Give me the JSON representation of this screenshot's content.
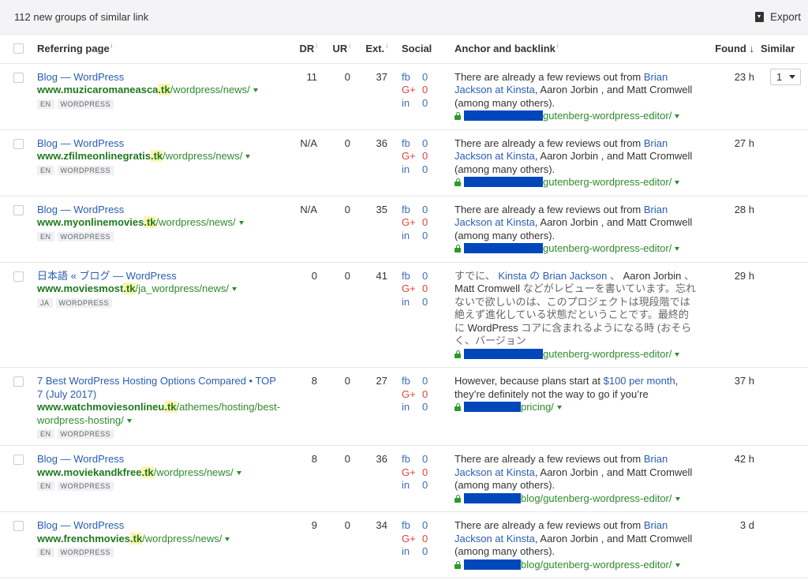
{
  "topbar": {
    "summary": "112 new groups of similar link",
    "export_label": "Export"
  },
  "columns": {
    "referring": "Referring page",
    "dr": "DR",
    "ur": "UR",
    "ext": "Ext.",
    "social": "Social",
    "anchor": "Anchor and backlink",
    "found": "Found",
    "similar": "Similar",
    "info": "i",
    "sort": "↓"
  },
  "social_labels": {
    "fb": "fb",
    "gp": "G+",
    "in": "in"
  },
  "rows": [
    {
      "title": "Blog — WordPress",
      "domain_pre": "www.muzicaromaneasca",
      "tld": ".tk",
      "path": "/wordpress/news/",
      "tags": [
        "EN",
        "WORDPRESS"
      ],
      "dr": "11",
      "ur": "0",
      "ext": "37",
      "fb": "0",
      "gp": "0",
      "in": "0",
      "anchor": [
        {
          "t": "There are already a few reviews out from "
        },
        {
          "t": "Brian Jackson at Kinsta",
          "l": 1
        },
        {
          "t": ", Aaron Jorbin , and Matt Cromwell (among many others)."
        }
      ],
      "redact": 100,
      "backlink": "gutenberg-wordpress-editor/",
      "found": "23 h",
      "similar": "1"
    },
    {
      "title": "Blog — WordPress",
      "domain_pre": "www.zfilmeonlinegratis",
      "tld": ".tk",
      "path": "/wordpress/news/",
      "tags": [
        "EN",
        "WORDPRESS"
      ],
      "dr": "N/A",
      "ur": "0",
      "ext": "36",
      "fb": "0",
      "gp": "0",
      "in": "0",
      "anchor": [
        {
          "t": "There are already a few reviews out from "
        },
        {
          "t": "Brian Jackson at Kinsta",
          "l": 1
        },
        {
          "t": ", Aaron Jorbin , and Matt Cromwell (among many others)."
        }
      ],
      "redact": 100,
      "backlink": "gutenberg-wordpress-editor/",
      "found": "27 h"
    },
    {
      "title": "Blog — WordPress",
      "domain_pre": "www.myonlinemovies",
      "tld": ".tk",
      "path": "/wordpress/news/",
      "tags": [
        "EN",
        "WORDPRESS"
      ],
      "dr": "N/A",
      "ur": "0",
      "ext": "35",
      "fb": "0",
      "gp": "0",
      "in": "0",
      "anchor": [
        {
          "t": "There are already a few reviews out from "
        },
        {
          "t": "Brian Jackson at Kinsta",
          "l": 1
        },
        {
          "t": ", Aaron Jorbin , and Matt Cromwell (among many others)."
        }
      ],
      "redact": 100,
      "backlink": "gutenberg-wordpress-editor/",
      "found": "28 h"
    },
    {
      "title": "日本語 « ブログ — WordPress",
      "domain_pre": "www.moviesmost",
      "tld": ".tk",
      "path": "/ja_wordpress/news/",
      "tags": [
        "JA",
        "WORDPRESS"
      ],
      "dr": "0",
      "ur": "0",
      "ext": "41",
      "fb": "0",
      "gp": "0",
      "in": "0",
      "ja": true,
      "anchor": [
        {
          "t": "すでに、 "
        },
        {
          "t": "Kinsta の Brian Jackson",
          "l": 1
        },
        {
          "t": " 、 "
        },
        {
          "t": "Aaron Jorbin",
          "e": 1
        },
        {
          "t": " 、 "
        },
        {
          "t": "Matt Cromwell",
          "e": 1
        },
        {
          "t": " などがレビューを書いています。忘れないで欲しいのは、このプロジェクトは現段階では絶えず進化している状態だということです。最終的に "
        },
        {
          "t": "WordPress",
          "e": 1
        },
        {
          "t": " コアに含まれるようになる時 (おそらく、バージョン"
        }
      ],
      "redact": 100,
      "backlink": "gutenberg-wordpress-editor/",
      "found": "29 h"
    },
    {
      "title": "7 Best WordPress Hosting Options Compared • TOP 7 (July 2017)",
      "domain_pre": "www.watchmoviesonlineu",
      "tld": ".tk",
      "path": "/athemes/hosting/best-wordpress-hosting/",
      "tags": [
        "EN",
        "WORDPRESS"
      ],
      "dr": "8",
      "ur": "0",
      "ext": "27",
      "fb": "0",
      "gp": "0",
      "in": "0",
      "anchor": [
        {
          "t": "However, because plans start at "
        },
        {
          "t": "$100 per month",
          "l": 1
        },
        {
          "t": ", they’re definitely not the way to go if you’re"
        }
      ],
      "redact": 72,
      "backlink": "pricing/",
      "found": "37 h"
    },
    {
      "title": "Blog — WordPress",
      "domain_pre": "www.moviekandkfree",
      "tld": ".tk",
      "path": "/wordpress/news/",
      "tags": [
        "EN",
        "WORDPRESS"
      ],
      "dr": "8",
      "ur": "0",
      "ext": "36",
      "fb": "0",
      "gp": "0",
      "in": "0",
      "anchor": [
        {
          "t": "There are already a few reviews out from "
        },
        {
          "t": "Brian Jackson at Kinsta",
          "l": 1
        },
        {
          "t": ", Aaron Jorbin , and Matt Cromwell (among many others)."
        }
      ],
      "redact": 72,
      "backlink": "blog/gutenberg-wordpress-editor/",
      "found": "42 h"
    },
    {
      "title": "Blog — WordPress",
      "domain_pre": "www.frenchmovies",
      "tld": ".tk",
      "path": "/wordpress/news/",
      "tags": [
        "EN",
        "WORDPRESS"
      ],
      "dr": "9",
      "ur": "0",
      "ext": "34",
      "fb": "0",
      "gp": "0",
      "in": "0",
      "anchor": [
        {
          "t": "There are already a few reviews out from "
        },
        {
          "t": "Brian Jackson at Kinsta",
          "l": 1
        },
        {
          "t": ", Aaron Jorbin , and Matt Cromwell (among many others)."
        }
      ],
      "redact": 72,
      "backlink": "blog/gutenberg-wordpress-editor/",
      "found": "3 d"
    }
  ]
}
